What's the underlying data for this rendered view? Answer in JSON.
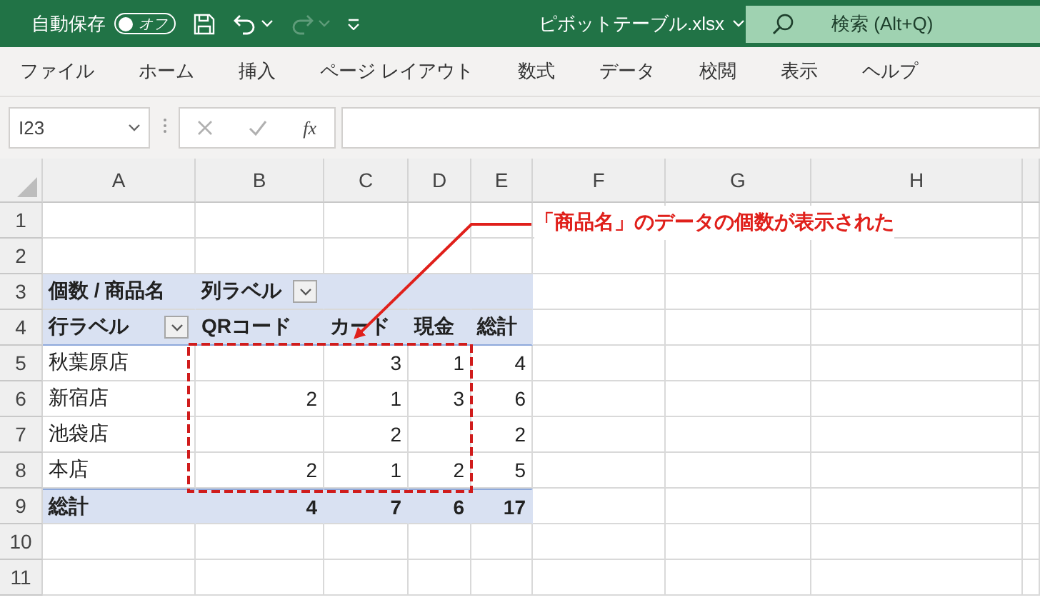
{
  "title_bar": {
    "autosave": {
      "label": "自動保存",
      "state_label": "オフ",
      "on": false
    },
    "redo_disabled": true,
    "file_name": "ピボットテーブル.xlsx",
    "search": {
      "placeholder": "検索 (Alt+Q)"
    }
  },
  "menu": [
    "ファイル",
    "ホーム",
    "挿入",
    "ページ レイアウト",
    "数式",
    "データ",
    "校閲",
    "表示",
    "ヘルプ"
  ],
  "formula_bar": {
    "name_box": "I23",
    "function_label": "fx"
  },
  "grid": {
    "columns": [
      "A",
      "B",
      "C",
      "D",
      "E",
      "F",
      "G",
      "H"
    ],
    "row_numbers": [
      "1",
      "2",
      "3",
      "4",
      "5",
      "6",
      "7",
      "8",
      "9",
      "10",
      "11"
    ]
  },
  "pivot_table": {
    "value_field": "個数 / 商品名",
    "column_label": "列ラベル",
    "row_label": "行ラベル",
    "columns": [
      "QRコード",
      "カード",
      "現金",
      "総計"
    ],
    "rows": [
      {
        "label": "秋葉原店",
        "values": [
          {
            "kind": "empty"
          },
          {
            "kind": "count",
            "text": "3"
          },
          {
            "kind": "count",
            "text": "1"
          },
          {
            "kind": "count",
            "text": "4"
          }
        ]
      },
      {
        "label": "新宿店",
        "values": [
          {
            "kind": "count",
            "text": "2"
          },
          {
            "kind": "count",
            "text": "1"
          },
          {
            "kind": "count",
            "text": "3"
          },
          {
            "kind": "count",
            "text": "6"
          }
        ]
      },
      {
        "label": "池袋店",
        "values": [
          {
            "kind": "empty"
          },
          {
            "kind": "count",
            "text": "2"
          },
          {
            "kind": "empty"
          },
          {
            "kind": "count",
            "text": "2"
          }
        ]
      },
      {
        "label": "本店",
        "values": [
          {
            "kind": "count",
            "text": "2"
          },
          {
            "kind": "count",
            "text": "1"
          },
          {
            "kind": "count",
            "text": "2"
          },
          {
            "kind": "count",
            "text": "5"
          }
        ]
      }
    ],
    "total": {
      "label": "総計",
      "values": [
        "4",
        "7",
        "6",
        "17"
      ]
    }
  },
  "callout": {
    "text": "「商品名」のデータの個数が表示された"
  }
}
